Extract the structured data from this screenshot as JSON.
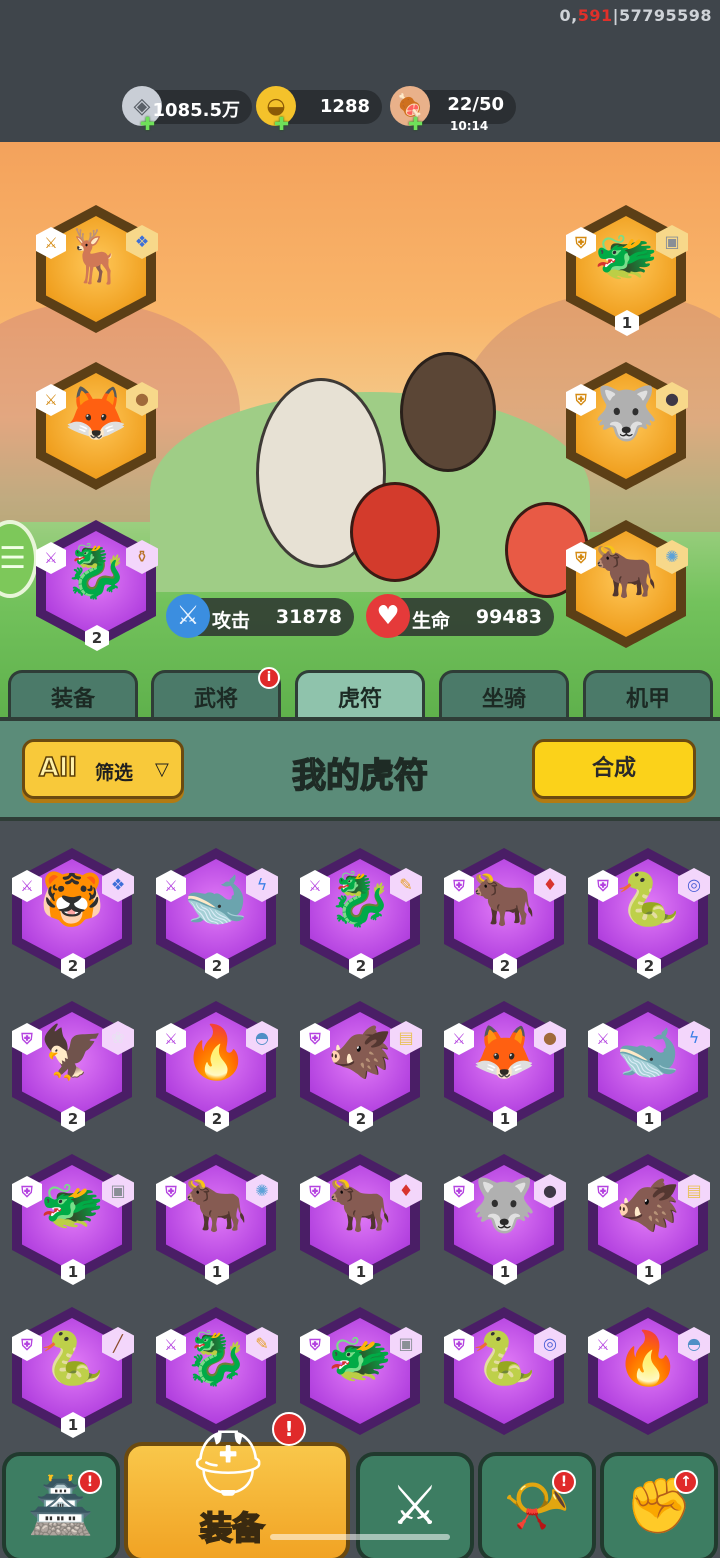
{
  "debug": {
    "prefix": "0,",
    "red": "591",
    "suffix": "|57795598"
  },
  "resources": {
    "silver": {
      "icon": "silver-coin-icon",
      "value": "1085.5万"
    },
    "gold": {
      "icon": "gold-ingot-icon",
      "value": "1288"
    },
    "stamina": {
      "icon": "meat-drumstick-icon",
      "value": "22/50",
      "timer": "10:14"
    }
  },
  "stats": {
    "attack": {
      "label": "攻击",
      "value": "31878"
    },
    "health": {
      "label": "生命",
      "value": "99483"
    }
  },
  "tabs": [
    "装备",
    "武将",
    "虎符",
    "坐骑",
    "机甲"
  ],
  "active_tab": 2,
  "tab_alert": "i",
  "header": {
    "filter_all": "All",
    "filter_label": "筛选",
    "title": "我的虎符",
    "combine_label": "合成"
  },
  "equipped": [
    {
      "animal": "deer-icon",
      "glyph": "🦌",
      "type": "sword-icon",
      "gem": "blue-token-icon",
      "color": "gold",
      "count": ""
    },
    {
      "animal": "fox-icon",
      "glyph": "🦊",
      "type": "sword-icon",
      "gem": "brown-orb-icon",
      "color": "gold",
      "count": ""
    },
    {
      "animal": "dragon-icon",
      "glyph": "🐉",
      "type": "sword-icon",
      "gem": "vase-icon",
      "color": "purple",
      "count": "2"
    },
    {
      "animal": "dragon-icon",
      "glyph": "🐲",
      "type": "shield-icon",
      "gem": "gray-box-icon",
      "color": "gold",
      "count": "1"
    },
    {
      "animal": "wolf-icon",
      "glyph": "🐺",
      "type": "shield-icon",
      "gem": "dark-orb-icon",
      "color": "gold",
      "count": ""
    },
    {
      "animal": "ox-icon",
      "glyph": "🐂",
      "type": "shield-icon",
      "gem": "swirl-icon",
      "color": "gold",
      "count": ""
    }
  ],
  "grid": [
    {
      "animal": "tiger-icon",
      "glyph": "🐯",
      "type": "sword-icon",
      "gem": "blue-token-icon",
      "count": "2"
    },
    {
      "animal": "whale-icon",
      "glyph": "🐋",
      "type": "sword-icon",
      "gem": "lightning-icon",
      "count": "2"
    },
    {
      "animal": "dragon-icon",
      "glyph": "🐉",
      "type": "sword-icon",
      "gem": "staff-icon",
      "count": "2"
    },
    {
      "animal": "ox-icon",
      "glyph": "🐂",
      "type": "shield-icon",
      "gem": "red-crystal-icon",
      "count": "2"
    },
    {
      "animal": "serpent-icon",
      "glyph": "🐍",
      "type": "shield-icon",
      "gem": "ring-icon",
      "count": "2"
    },
    {
      "animal": "phoenix-icon",
      "glyph": "🦅",
      "type": "shield-icon",
      "gem": "lotus-icon",
      "count": "2"
    },
    {
      "animal": "flame-icon",
      "glyph": "🔥",
      "type": "sword-icon",
      "gem": "helmet-icon",
      "count": "2"
    },
    {
      "animal": "boar-icon",
      "glyph": "🐗",
      "type": "shield-icon",
      "gem": "scroll-icon",
      "count": "2"
    },
    {
      "animal": "fox-icon",
      "glyph": "🦊",
      "type": "sword-icon",
      "gem": "brown-orb-icon",
      "count": "1"
    },
    {
      "animal": "whale-icon",
      "glyph": "🐋",
      "type": "sword-icon",
      "gem": "lightning-icon",
      "count": "1"
    },
    {
      "animal": "dragon-icon",
      "glyph": "🐲",
      "type": "shield-icon",
      "gem": "gray-box-icon",
      "count": "1"
    },
    {
      "animal": "ox-icon",
      "glyph": "🐂",
      "type": "shield-icon",
      "gem": "swirl-icon",
      "count": "1"
    },
    {
      "animal": "ox-icon",
      "glyph": "🐂",
      "type": "shield-icon",
      "gem": "red-crystal-icon",
      "count": "1"
    },
    {
      "animal": "wolf-icon",
      "glyph": "🐺",
      "type": "shield-icon",
      "gem": "dark-orb-icon",
      "count": "1"
    },
    {
      "animal": "boar-icon",
      "glyph": "🐗",
      "type": "shield-icon",
      "gem": "scroll-icon",
      "count": "1"
    },
    {
      "animal": "serpent-icon",
      "glyph": "🐍",
      "type": "shield-icon",
      "gem": "brush-icon",
      "count": "1"
    },
    {
      "animal": "dragon-icon",
      "glyph": "🐉",
      "type": "sword-icon",
      "gem": "staff-icon",
      "count": ""
    },
    {
      "animal": "dragon-icon",
      "glyph": "🐲",
      "type": "shield-icon",
      "gem": "gray-box-icon",
      "count": ""
    },
    {
      "animal": "serpent-icon",
      "glyph": "🐍",
      "type": "shield-icon",
      "gem": "ring-icon",
      "count": ""
    },
    {
      "animal": "flame-icon",
      "glyph": "🔥",
      "type": "sword-icon",
      "gem": "helmet-icon",
      "count": ""
    }
  ],
  "bottom_nav": [
    {
      "icon": "shop-gate-icon",
      "glyph": "🏯",
      "alert": "!"
    },
    {
      "icon": "helmet-icon",
      "glyph": "⛑",
      "label": "装备",
      "alert": "!"
    },
    {
      "icon": "crossed-swords-icon",
      "glyph": "⚔",
      "alert": ""
    },
    {
      "icon": "warhorn-icon",
      "glyph": "📯",
      "alert": "!"
    },
    {
      "icon": "upgrade-fist-icon",
      "glyph": "✊",
      "alert": "↑"
    }
  ],
  "colors": {
    "gold": "#f0a020",
    "purple": "#b443e0",
    "panel": "#5b8c79",
    "tab_active": "#8fc3ac"
  }
}
